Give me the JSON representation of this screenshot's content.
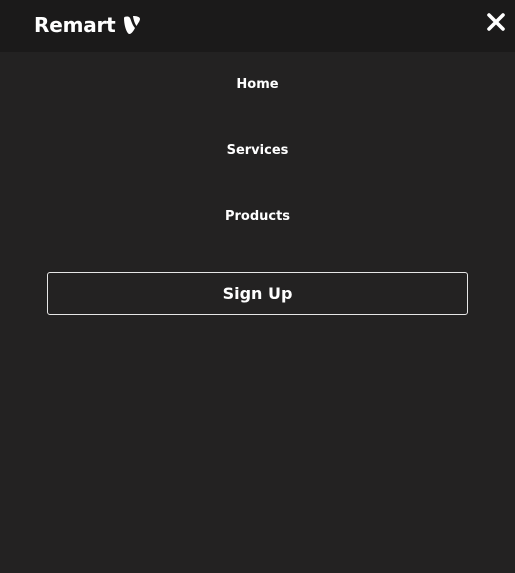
{
  "brand": {
    "name": "Remart",
    "logo_icon": "typo3-logo-icon"
  },
  "header": {
    "close_icon": "close-icon"
  },
  "nav": {
    "items": [
      {
        "label": "Home"
      },
      {
        "label": "Services"
      },
      {
        "label": "Products"
      }
    ]
  },
  "cta": {
    "signup_label": "Sign Up"
  },
  "colors": {
    "background": "#232222",
    "header_background": "#1b1a1a",
    "text": "#ffffff",
    "button_border": "#e6e6e6"
  }
}
